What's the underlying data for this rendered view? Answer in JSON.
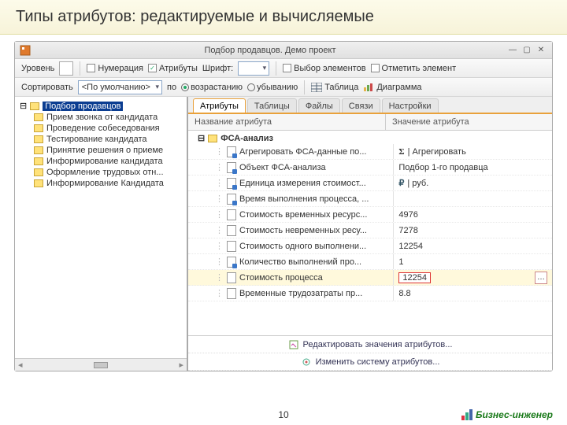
{
  "slide": {
    "title": "Типы атрибутов: редактируемые и вычисляемые",
    "page": "10",
    "brand": "Бизнес-инженер"
  },
  "window": {
    "title": "Подбор продавцов. Демо проект"
  },
  "toolbar1": {
    "level_lbl": "Уровень",
    "numbering": "Нумерация",
    "attributes": "Атрибуты",
    "font": "Шрифт:",
    "select_elems": "Выбор элементов",
    "mark_elem": "Отметить элемент"
  },
  "toolbar2": {
    "sort_lbl": "Сортировать",
    "sort_default": "<По умолчанию>",
    "by_lbl": "по",
    "asc": "возрастанию",
    "desc": "убыванию",
    "table_btn": "Таблица",
    "chart_btn": "Диаграмма"
  },
  "tree": {
    "root": "Подбор продавцов",
    "items": [
      "Прием звонка от кандидата",
      "Проведение собеседования",
      "Тестирование кандидата",
      "Принятие решения о приеме",
      "Информирование кандидата",
      "Оформление трудовых отн...",
      "Информирование Кандидата"
    ]
  },
  "tabs": {
    "attributes": "Атрибуты",
    "tables": "Таблицы",
    "files": "Файлы",
    "links": "Связи",
    "settings": "Настройки"
  },
  "grid": {
    "col_name": "Название атрибута",
    "col_val": "Значение атрибута"
  },
  "group": {
    "label": "ФСА-анализ"
  },
  "attrs": [
    {
      "name": "Агрегировать ФСА-данные по...",
      "val": "| Агрегировать",
      "editable": true,
      "sigma": true
    },
    {
      "name": "Объект ФСА-анализа",
      "val": "Подбор 1-го продавца",
      "editable": true
    },
    {
      "name": "Единица измерения стоимост...",
      "val": "| руб.",
      "editable": true,
      "currency": true
    },
    {
      "name": "Время выполнения процесса, ...",
      "val": "",
      "editable": true
    },
    {
      "name": "Стоимость временных ресурс...",
      "val": "4976",
      "editable": false
    },
    {
      "name": "Стоимость невременных ресу...",
      "val": "7278",
      "editable": false
    },
    {
      "name": "Стоимость одного выполнени...",
      "val": "12254",
      "editable": false
    },
    {
      "name": "Количество выполнений про...",
      "val": "1",
      "editable": true
    },
    {
      "name": "Стоимость процесса",
      "val": "12254",
      "editable": false,
      "highlight": true
    },
    {
      "name": "Временные трудозатраты пр...",
      "val": "8.8",
      "editable": false
    }
  ],
  "actions": {
    "edit_values": "Редактировать значения атрибутов...",
    "change_system": "Изменить систему атрибутов..."
  }
}
